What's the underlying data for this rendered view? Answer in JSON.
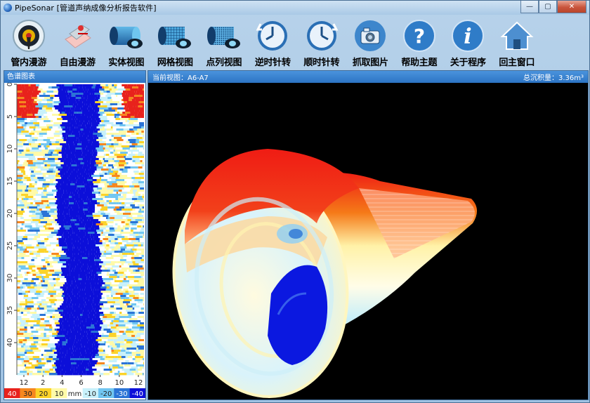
{
  "window": {
    "title": "PipeSonar [管道声纳成像分析报告软件]",
    "minimize_glyph": "—",
    "maximize_glyph": "▢",
    "close_glyph": "✕"
  },
  "toolbar": {
    "items": [
      {
        "label": "管内漫游",
        "icon": "pipe-inside-roam-icon"
      },
      {
        "label": "自由漫游",
        "icon": "free-roam-icon"
      },
      {
        "label": "实体视图",
        "icon": "solid-view-icon"
      },
      {
        "label": "网格视图",
        "icon": "mesh-view-icon"
      },
      {
        "label": "点列视图",
        "icon": "point-view-icon"
      },
      {
        "label": "逆时针转",
        "icon": "rotate-ccw-icon"
      },
      {
        "label": "顺时针转",
        "icon": "rotate-cw-icon"
      },
      {
        "label": "抓取图片",
        "icon": "camera-icon"
      },
      {
        "label": "帮助主题",
        "icon": "help-icon"
      },
      {
        "label": "关于程序",
        "icon": "info-icon"
      },
      {
        "label": "回主窗口",
        "icon": "home-icon"
      }
    ]
  },
  "left_panel": {
    "title": "色谱图表",
    "chart_data": {
      "type": "heatmap",
      "y_ticks": [
        "0",
        "5",
        "10",
        "15",
        "20",
        "25",
        "30",
        "35",
        "40"
      ],
      "x_ticks": [
        "12",
        "2",
        "4",
        "6",
        "8",
        "10",
        "12"
      ],
      "legend": {
        "items": [
          {
            "label": "40",
            "color": "#e8221c"
          },
          {
            "label": "30",
            "color": "#f6871f"
          },
          {
            "label": "20",
            "color": "#fbd32a"
          },
          {
            "label": "10",
            "color": "#fffaa8"
          },
          {
            "label": "mm",
            "color": "#ffffff"
          },
          {
            "label": "-10",
            "color": "#c8f1fb"
          },
          {
            "label": "-20",
            "color": "#71c6f1"
          },
          {
            "label": "-30",
            "color": "#2b74d6"
          },
          {
            "label": "-40",
            "color": "#0c0fd9"
          }
        ]
      }
    }
  },
  "right_panel": {
    "current_view_label": "当前视图：A6-A7",
    "total_sediment_label": "总沉积量：3.36m³"
  },
  "colors": {
    "panel_header": "#2c74c4",
    "red": "#ef1f14",
    "blue": "#0b18e0",
    "cream": "#fff7c8"
  }
}
